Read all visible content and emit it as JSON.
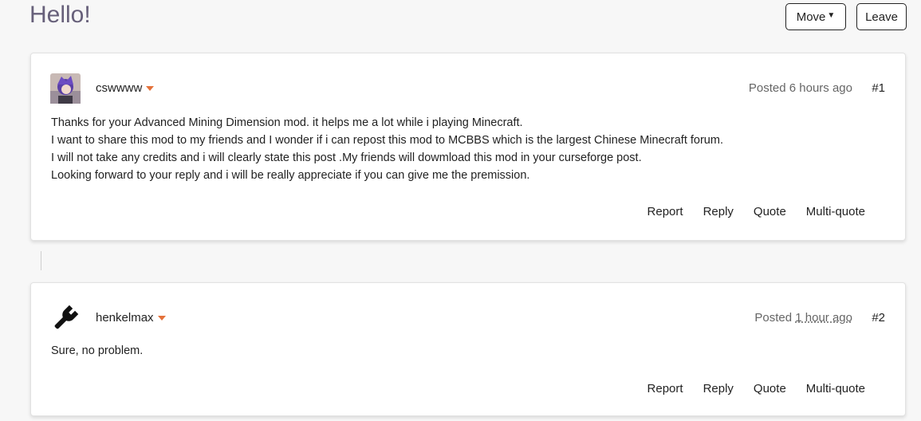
{
  "page": {
    "title": "Hello!"
  },
  "toolbar": {
    "move_label": "Move",
    "leave_label": "Leave"
  },
  "posts": [
    {
      "username": "cswwww",
      "posted_prefix": "Posted",
      "posted_time": "6 hours ago",
      "number": "#1",
      "avatar": "user-avatar-image",
      "lines": [
        "Thanks for your Advanced Mining Dimension mod. it helps me a lot while i playing Minecraft.",
        "I want to share this mod to my friends and I wonder if i can repost this mod to MCBBS which is the largest Chinese Minecraft forum.",
        "I will not take any credits and i will clearly state this post .My friends will dowmload this mod in your curseforge post.",
        "Looking forward to your reply and i will be really appreciate if you can give me the premission."
      ],
      "actions": {
        "report": "Report",
        "reply": "Reply",
        "quote": "Quote",
        "multiquote": "Multi-quote"
      }
    },
    {
      "username": "henkelmax",
      "posted_prefix": "Posted",
      "posted_time": "1 hour ago",
      "number": "#2",
      "avatar": "wrench-icon",
      "lines": [
        "Sure, no problem."
      ],
      "actions": {
        "report": "Report",
        "reply": "Reply",
        "quote": "Quote",
        "multiquote": "Multi-quote"
      }
    }
  ],
  "colors": {
    "title": "#67607a",
    "accent_caret": "#e4713a"
  }
}
